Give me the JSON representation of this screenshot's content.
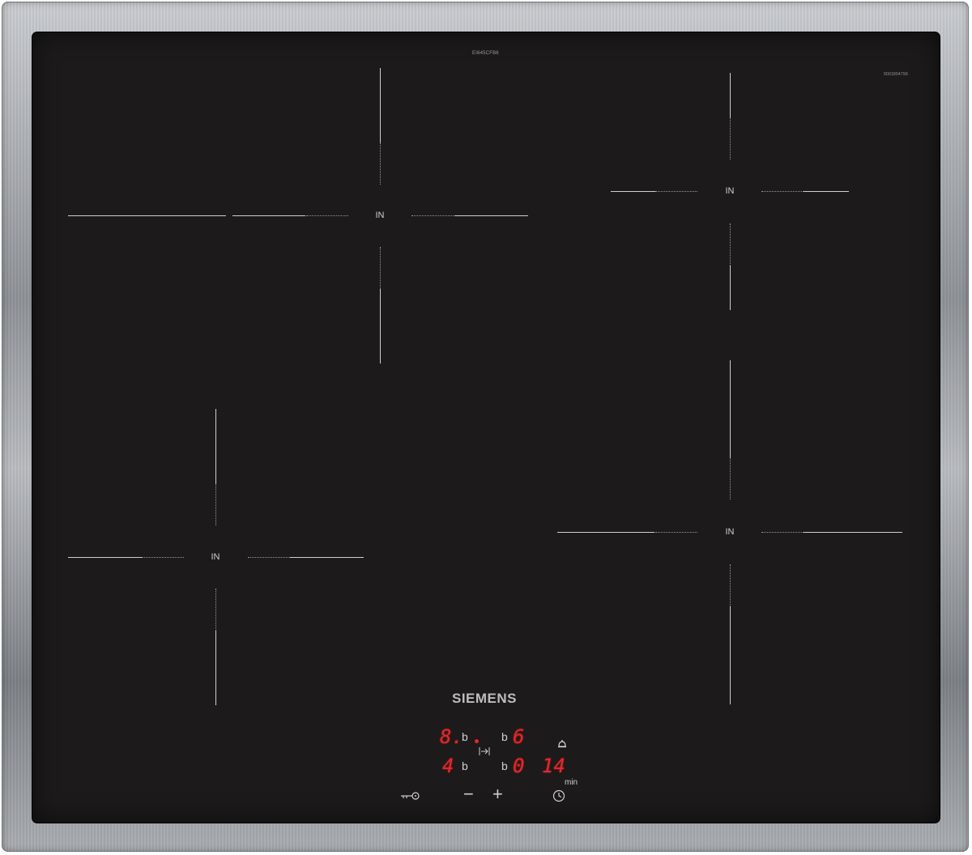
{
  "model_code": "EI645CFB6",
  "serial_code": "9001804799",
  "zones": [
    {
      "id": "front-left-rear",
      "label": "IN"
    },
    {
      "id": "rear-right",
      "label": "IN"
    },
    {
      "id": "front-left",
      "label": "IN"
    },
    {
      "id": "front-right",
      "label": "IN"
    }
  ],
  "brand": "SIEMENS",
  "display": {
    "top_left_digit": "8.",
    "top_left_b": "b",
    "top_right_b": "b",
    "top_right_digit": "6",
    "bottom_left_digit": "4",
    "bottom_left_b": "b",
    "bottom_right_b": "b",
    "bottom_digit_a": "0",
    "bottom_digits_b": "14",
    "timer_unit": "min"
  },
  "controls": {
    "minus_label": "−",
    "plus_label": "+"
  },
  "icons": [
    "key-lock-icon",
    "minus-icon",
    "plus-icon",
    "timer-clock-icon",
    "bell-icon",
    "power-boost-icon"
  ],
  "colors": {
    "glass": "#1c1a1a",
    "display_red": "#e8262b",
    "frame": "#9a9da1"
  }
}
